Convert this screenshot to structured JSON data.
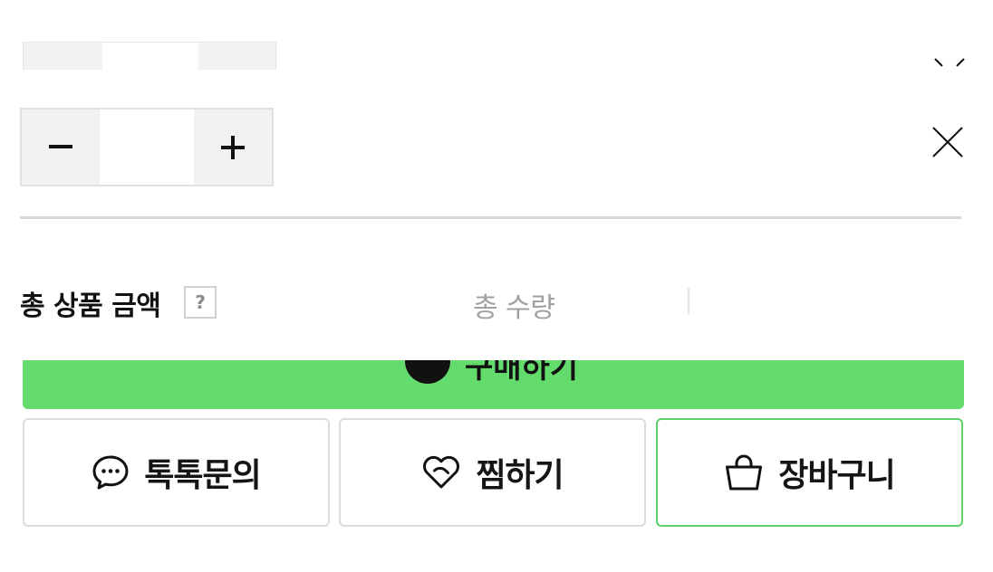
{
  "quantity_stepper": {
    "value": "",
    "decrement_label": "minus",
    "increment_label": "plus"
  },
  "summary": {
    "total_price_label": "총 상품 금액",
    "help_label": "?",
    "total_quantity_label": "총 수량"
  },
  "buy_button": {
    "label": "구매하기",
    "icon": "naver-pay-icon"
  },
  "actions": {
    "talk_label": "톡톡문의",
    "wish_label": "찜하기",
    "cart_label": "장바구니"
  },
  "icons": {
    "talk": "chat-bubble-icon",
    "wish": "heart-icon",
    "cart": "shopping-bag-icon",
    "close": "close-icon",
    "chevron": "chevron-down-icon"
  },
  "colors": {
    "buy_button": "#64db6d",
    "cart_border": "#5fd069",
    "stepper_button_bg": "#f1f2f4"
  }
}
